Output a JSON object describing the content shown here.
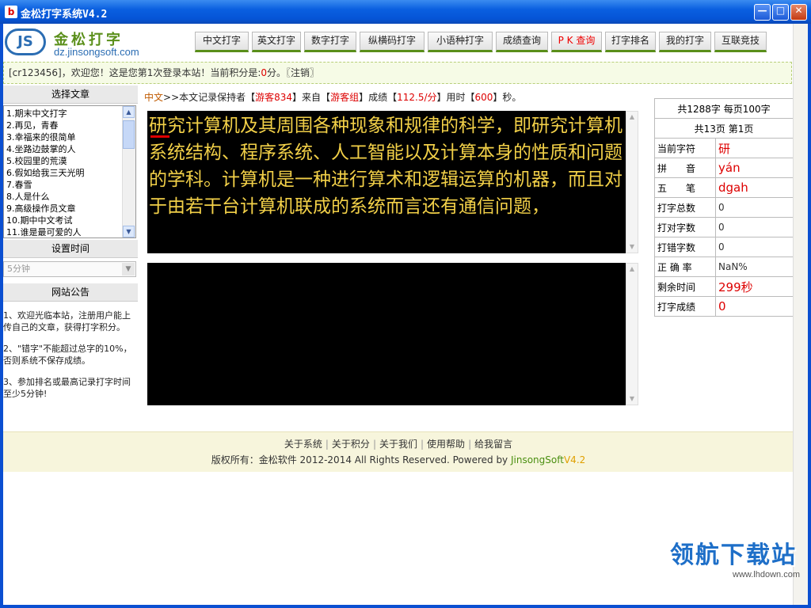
{
  "window": {
    "title": "金松打字系统V4.2",
    "icon_text": "b",
    "buttons": {
      "minimize": "—",
      "maximize": "□",
      "close": "✕"
    }
  },
  "header": {
    "logo_badge": "JS",
    "brand": "金松打字",
    "domain": "dz.jinsongsoft.com",
    "nav": [
      {
        "label": "中文打字"
      },
      {
        "label": "英文打字"
      },
      {
        "label": "数字打字"
      },
      {
        "label": "纵横码打字"
      },
      {
        "label": "小语种打字"
      },
      {
        "label": "成绩查询"
      },
      {
        "label": "P K 查询"
      },
      {
        "label": "打字排名"
      },
      {
        "label": "我的打字"
      },
      {
        "label": "互联竞技"
      }
    ]
  },
  "welcome": {
    "prefix": "[cr123456]，欢迎您！这是您第1次登录本站！当前积分是:",
    "score": "0",
    "suffix": "分。〖注销〗"
  },
  "sidebar": {
    "article_heading": "选择文章",
    "articles": [
      "1.期末中文打字",
      "2.再见，青春",
      "3.幸福来的很简单",
      "4.坐路边鼓掌的人",
      "5.校园里的荒漠",
      "6.假如给我三天光明",
      "7.春雪",
      "8.人是什么",
      "9.高级操作员文章",
      "10.期中中文考试",
      "11.谁是最可爱的人"
    ],
    "time_heading": "设置时间",
    "time_value": "5分钟",
    "notice_heading": "网站公告",
    "notices": [
      "1、欢迎光临本站，注册用户能上传自己的文章，获得打字积分。",
      "2、\"错字\"不能超过总字的10%，否则系统不保存成绩。",
      "3、参加排名或最高记录打字时间至少5分钟!"
    ]
  },
  "record": {
    "lang": "中文",
    "arrow": ">>",
    "t1": "本文记录保持者【",
    "holder": "游客834",
    "t2": "】来自【",
    "group": "游客组",
    "t3": "】成绩【",
    "score": "112.5/分",
    "t4": "】用时【",
    "time": "600",
    "t5": "】秒。"
  },
  "practice": {
    "text": "研究计算机及其周围各种现象和规律的科学，即研究计算机系统结构、程序系统、人工智能以及计算本身的性质和问题的学科。计算机是一种进行算术和逻辑运算的机器，而且对于由若干台计算机联成的系统而言还有通信问题，"
  },
  "stats": {
    "total": "共1288字  每页100字",
    "pages": "共13页  第1页",
    "rows": [
      {
        "label": "当前字符",
        "value": "研",
        "style": "red"
      },
      {
        "label": "拼　　音",
        "value": "yán",
        "style": "red"
      },
      {
        "label": "五　　笔",
        "value": "dgah",
        "style": "red"
      },
      {
        "label": "打字总数",
        "value": "0",
        "style": "val"
      },
      {
        "label": "打对字数",
        "value": "0",
        "style": "val"
      },
      {
        "label": "打错字数",
        "value": "0",
        "style": "val"
      },
      {
        "label": "正 确 率",
        "value": "NaN%",
        "style": "val"
      },
      {
        "label": "剩余时间",
        "value": "299秒",
        "style": "red"
      },
      {
        "label": "打字成绩",
        "value": "0",
        "style": "red"
      }
    ]
  },
  "footer": {
    "links": [
      "关于系统",
      "关于积分",
      "关于我们",
      "使用帮助",
      "给我留言"
    ],
    "copyright_prefix": "版权所有：金松软件  2012-2014 All Rights Reserved. Powered by ",
    "brand": "JinsongSoft",
    "version": "V4.2"
  },
  "watermark": {
    "text": "领航下载站",
    "url": "www.lhdown.com"
  },
  "colors": {
    "title_bar": "#0554d6",
    "accent_green": "#5a8f1a",
    "highlight_red": "#dd0000",
    "text_yellow": "#f2d048"
  }
}
